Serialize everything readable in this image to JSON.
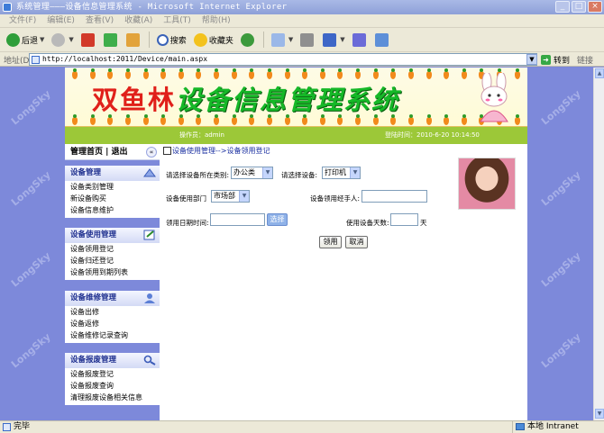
{
  "window": {
    "title": "系统管理———设备信息管理系统 - Microsoft Internet Explorer",
    "controls": [
      "_",
      "□",
      "×"
    ]
  },
  "menu": [
    "文件(F)",
    "编辑(E)",
    "查看(V)",
    "收藏(A)",
    "工具(T)",
    "帮助(H)"
  ],
  "toolbar": {
    "back": "后退",
    "search": "搜索",
    "favorites": "收藏夹"
  },
  "address": {
    "label": "地址(D)",
    "url": "http://localhost:2011/Device/main.aspx",
    "go": "转到",
    "links": "链接"
  },
  "watermark": "LongSky",
  "banner": {
    "title_part1": "双鱼林",
    "title_part2": "设备信息管理系统"
  },
  "header": {
    "operator": "操作员：admin",
    "login_time": "登陆时间：2010-6-20  10:14:50"
  },
  "nav": {
    "top": "管理首页 | 退出",
    "collapse": "«",
    "sections": [
      {
        "title": "设备管理",
        "icon": "gear-icon",
        "items": [
          "设备类别管理",
          "新设备购买",
          "设备信息维护"
        ]
      },
      {
        "title": "设备使用管理",
        "icon": "edit-icon",
        "items": [
          "设备领用登记",
          "设备归还登记",
          "设备领用到期列表"
        ]
      },
      {
        "title": "设备维修管理",
        "icon": "user-icon",
        "items": [
          "设备出修",
          "设备返修",
          "设备维修记录查询"
        ]
      },
      {
        "title": "设备报废管理",
        "icon": "search-icon",
        "items": [
          "设备报废登记",
          "设备报废查询",
          "清理报废设备相关信息"
        ]
      }
    ]
  },
  "main": {
    "breadcrumb": "设备使用管理-->设备领用登记",
    "category_label": "请选择设备所在类别:",
    "category_value": "办公类",
    "device_label": "请选择设备:",
    "device_value": "打印机",
    "dept_label": "设备使用部门",
    "dept_value": "市场部",
    "handler_label": "设备领用经手人:",
    "handler_value": "",
    "date_label": "领用日期时间:",
    "date_value": "",
    "pick_button": "选择",
    "days_label": "使用设备天数:",
    "days_value": "",
    "days_unit": "天",
    "submit_button": "领用",
    "cancel_button": "取消"
  },
  "status": {
    "text": "完毕",
    "zone": "本地 Intranet"
  }
}
